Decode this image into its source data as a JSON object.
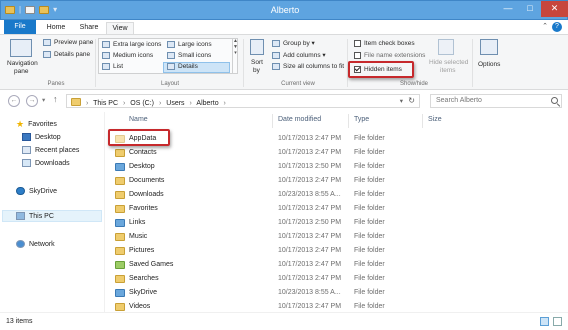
{
  "window": {
    "title": "Alberto",
    "min": "—",
    "max": "□",
    "close": "✕"
  },
  "tabs": {
    "file": "File",
    "home": "Home",
    "share": "Share",
    "view": "View"
  },
  "ribbon": {
    "panes": {
      "navigation_pane": "Navigation",
      "navigation_pane_2": "pane",
      "preview_pane": "Preview pane",
      "details_pane": "Details pane",
      "group": "Panes"
    },
    "layout": {
      "extra_large": "Extra large icons",
      "large": "Large icons",
      "medium": "Medium icons",
      "small": "Small icons",
      "list": "List",
      "details": "Details",
      "group": "Layout"
    },
    "current_view": {
      "sort_by": "Sort",
      "sort_by_2": "by",
      "group_by": "Group by",
      "add_columns": "Add columns",
      "size_all": "Size all columns to fit",
      "group": "Current view"
    },
    "show_hide": {
      "item_checkboxes": "Item check boxes",
      "file_name_extensions": "File name extensions",
      "hidden_items": "Hidden items",
      "hidden_items_checked": true,
      "hide_selected": "Hide selected",
      "hide_selected_2": "items",
      "group": "Show/hide"
    },
    "options": "Options"
  },
  "address": {
    "crumbs": [
      "This PC",
      "OS (C:)",
      "Users",
      "Alberto"
    ],
    "search_placeholder": "Search Alberto"
  },
  "nav": {
    "favorites": "Favorites",
    "desktop": "Desktop",
    "recent": "Recent places",
    "downloads": "Downloads",
    "skydrive": "SkyDrive",
    "thispc": "This PC",
    "network": "Network"
  },
  "columns": {
    "name": "Name",
    "date": "Date modified",
    "type": "Type",
    "size": "Size"
  },
  "files": [
    {
      "name": "AppData",
      "date": "10/17/2013 2:47 PM",
      "type": "File folder"
    },
    {
      "name": "Contacts",
      "date": "10/17/2013 2:47 PM",
      "type": "File folder"
    },
    {
      "name": "Desktop",
      "date": "10/17/2013 2:50 PM",
      "type": "File folder"
    },
    {
      "name": "Documents",
      "date": "10/17/2013 2:47 PM",
      "type": "File folder"
    },
    {
      "name": "Downloads",
      "date": "10/23/2013 8:55 A...",
      "type": "File folder"
    },
    {
      "name": "Favorites",
      "date": "10/17/2013 2:47 PM",
      "type": "File folder"
    },
    {
      "name": "Links",
      "date": "10/17/2013 2:50 PM",
      "type": "File folder"
    },
    {
      "name": "Music",
      "date": "10/17/2013 2:47 PM",
      "type": "File folder"
    },
    {
      "name": "Pictures",
      "date": "10/17/2013 2:47 PM",
      "type": "File folder"
    },
    {
      "name": "Saved Games",
      "date": "10/17/2013 2:47 PM",
      "type": "File folder"
    },
    {
      "name": "Searches",
      "date": "10/17/2013 2:47 PM",
      "type": "File folder"
    },
    {
      "name": "SkyDrive",
      "date": "10/23/2013 8:55 A...",
      "type": "File folder"
    },
    {
      "name": "Videos",
      "date": "10/17/2013 2:47 PM",
      "type": "File folder"
    }
  ],
  "status": {
    "count": "13 items"
  }
}
